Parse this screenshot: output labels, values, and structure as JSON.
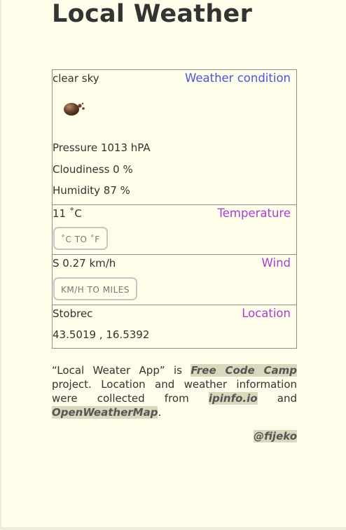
{
  "page": {
    "title": "Local Weather",
    "background": "#fefde9"
  },
  "condition": {
    "description": "clear sky",
    "heading": "Weather condition",
    "icon": "clear-sky-weather-icon",
    "pressure": "Pressure 1013 hPA",
    "cloudiness": "Cloudiness 0 %",
    "humidity": "Humidity 87 %",
    "heading_color": "#4a55df"
  },
  "temperature": {
    "value": "11 ˚C",
    "heading": "Temperature",
    "toggle_label": "˚C TO ˚F",
    "heading_color": "#a63fd6"
  },
  "wind": {
    "value": "S 0.27 km/h",
    "heading": "Wind",
    "toggle_label": "KM/H TO MILES"
  },
  "location": {
    "city": "Stobrec",
    "coords": "43.5019 , 16.5392",
    "heading": "Location"
  },
  "footer": {
    "part1": "“Local Weater App” is ",
    "fcc": "Free Code Camp",
    "part2": " project. Location and weather information were collected from ",
    "ipinfo": "ipinfo.io",
    "part3": " and ",
    "owm": "OpenWeatherMap",
    "part4": ".",
    "credit": "@fijeko",
    "highlight_color": "#d8d8bc"
  }
}
